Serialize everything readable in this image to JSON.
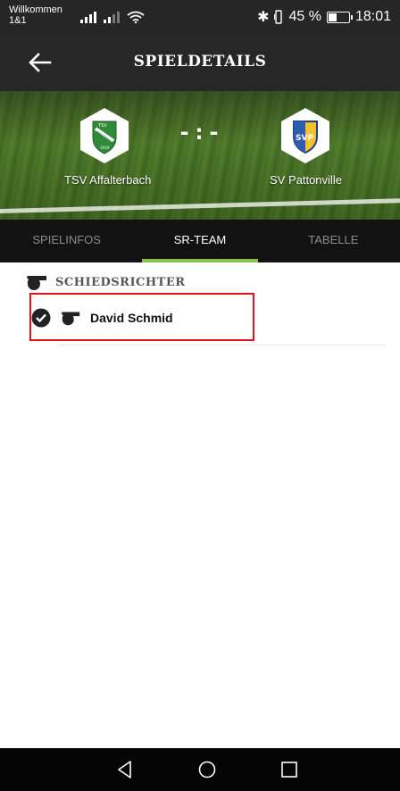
{
  "status_bar": {
    "carrier_line1": "Willkommen",
    "carrier_line2": "1&1",
    "bluetooth": "✱",
    "battery_percent": "45 %",
    "battery_level": 0.45,
    "time": "18:01"
  },
  "app_bar": {
    "title": "SPIELDETAILS"
  },
  "match": {
    "score": "-:-",
    "home_team": "TSV Affalterbach",
    "away_team": "SV Pattonville",
    "home_badge_text": [
      "TSV",
      "AFFALTERBACH",
      "1919"
    ],
    "away_badge_text": "SVP"
  },
  "tabs": [
    {
      "label": "SPIELINFOS",
      "active": false
    },
    {
      "label": "SR-TEAM",
      "active": true
    },
    {
      "label": "TABELLE",
      "active": false
    }
  ],
  "referees": {
    "section_title": "SCHIEDSRICHTER",
    "items": [
      {
        "name": "David Schmid",
        "confirmed": true
      }
    ]
  },
  "colors": {
    "accent": "#8bc34a",
    "highlight_border": "#e1141b",
    "app_bar": "#272727",
    "tabs_bg": "#121212"
  },
  "icons": {
    "back": "arrow-left-icon",
    "whistle": "whistle-icon",
    "check": "check-circle-icon",
    "nav_back": "triangle-back-icon",
    "nav_home": "circle-home-icon",
    "nav_recent": "square-recent-icon"
  }
}
